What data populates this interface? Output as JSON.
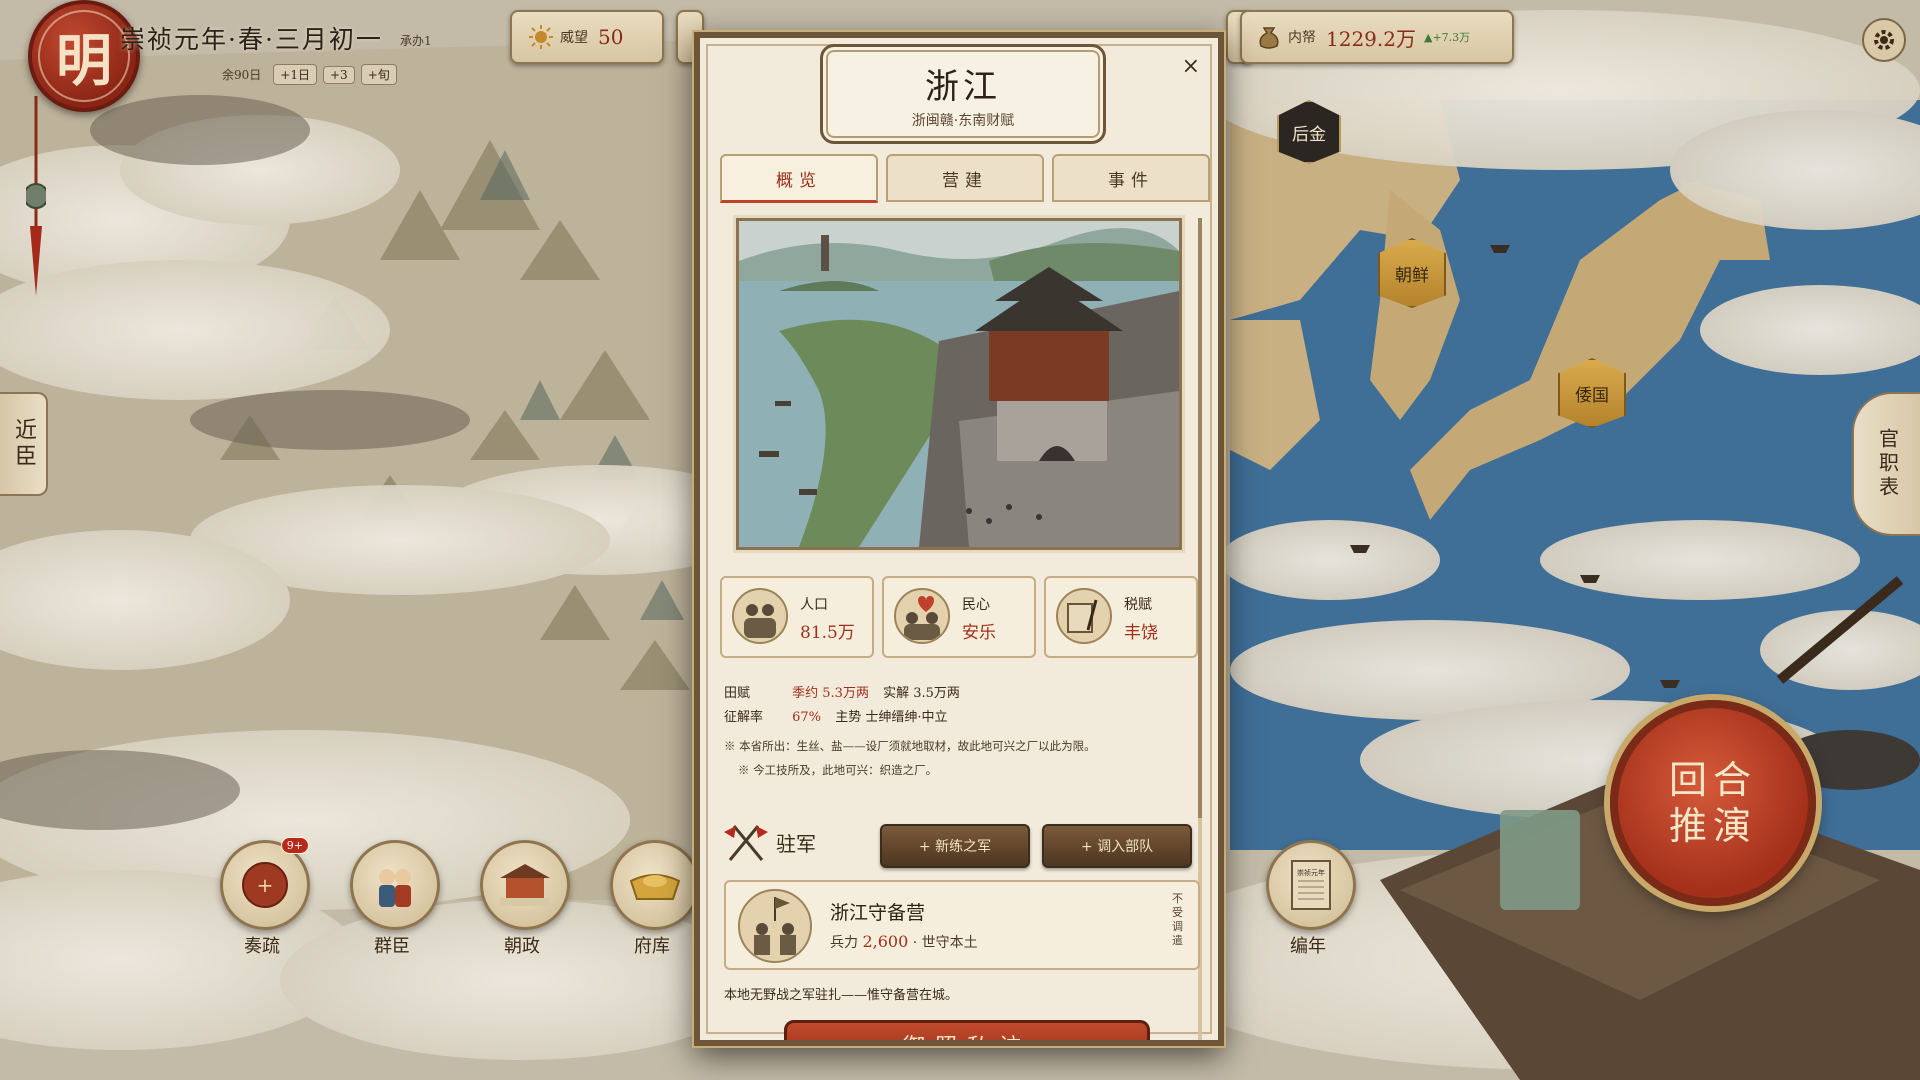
{
  "header": {
    "seal": "明",
    "date": "崇祯元年·春·三月初一",
    "sub": "承办1",
    "remaining": "余90日",
    "skip_buttons": [
      "+1日",
      "+3",
      "+旬"
    ]
  },
  "resources": {
    "prestige_label": "威望",
    "prestige_value": "50",
    "treasury_label": "内帑",
    "treasury_value": "1229.2万",
    "treasury_delta": "▲+7.3万"
  },
  "side_tabs": {
    "left": "近臣",
    "right": "官职表"
  },
  "map_labels": [
    "后金",
    "朝鲜",
    "倭国"
  ],
  "bottom_buttons": [
    {
      "label": "奏疏",
      "badge": "9+",
      "icon": "memorial-icon"
    },
    {
      "label": "群臣",
      "icon": "ministers-icon"
    },
    {
      "label": "朝政",
      "icon": "palace-icon"
    },
    {
      "label": "府库",
      "icon": "gold-ingot-icon"
    }
  ],
  "chronicle_label": "编年",
  "chronicle_book_text": "崇祯元年",
  "end_turn": {
    "line1": "回合",
    "line2": "推演"
  },
  "province": {
    "name": "浙江",
    "subtitle": "浙闽赣·东南财赋",
    "close": "×",
    "tabs": [
      "概览",
      "营建",
      "事件"
    ],
    "active_tab": 0,
    "stats": [
      {
        "label": "人口",
        "value": "81.5万",
        "icon": "population-icon"
      },
      {
        "label": "民心",
        "value": "安乐",
        "icon": "morale-icon"
      },
      {
        "label": "税赋",
        "value": "丰饶",
        "icon": "tax-icon"
      }
    ],
    "field_tax": {
      "label": "田赋",
      "plan": "季约 5.3万两",
      "actual": "实解 3.5万两"
    },
    "collection": {
      "label": "征解率",
      "rate": "67%",
      "trend": "主势 士绅缙绅·中立"
    },
    "note1": "※ 本省所出：生丝、盐——设厂须就地取材，故此地可兴之厂以此为限。",
    "note2": "※ 今工技所及，此地可兴：织造之厂。",
    "garrison": {
      "title": "驻军",
      "btn_train": "+ 新练之军",
      "btn_transfer": "+ 调入部队",
      "unit_name": "浙江守备营",
      "unit_detail_prefix": "兵力",
      "unit_strength": "2,600",
      "unit_detail_suffix": "· 世守本土",
      "unit_side": "不受调遣",
      "footnote": "本地无野战之军驻扎——惟守备营在城。"
    },
    "bottom_button": "御照私访"
  }
}
